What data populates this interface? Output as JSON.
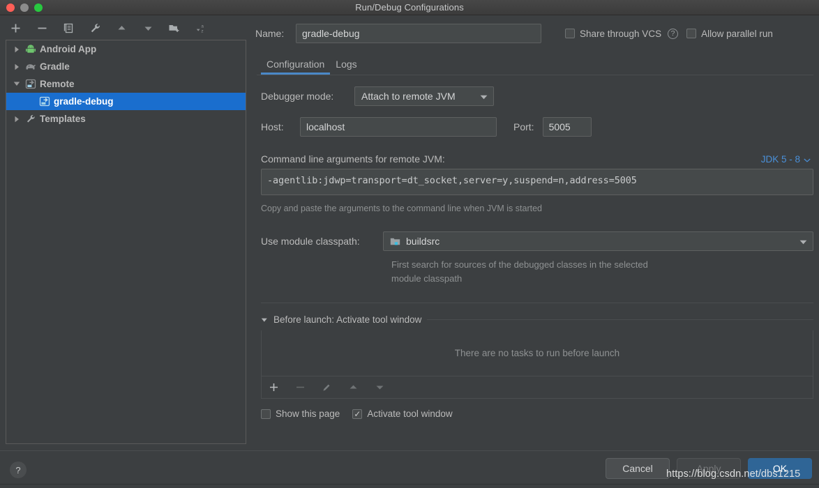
{
  "window": {
    "title": "Run/Debug Configurations",
    "traffic_lights": [
      "close",
      "minimize",
      "zoom"
    ]
  },
  "left_toolbar": {
    "buttons": [
      {
        "name": "add-configuration",
        "icon": "plus-icon"
      },
      {
        "name": "remove-configuration",
        "icon": "minus-icon"
      },
      {
        "name": "copy-configuration",
        "icon": "copy-icon"
      },
      {
        "name": "edit-templates",
        "icon": "wrench-icon"
      },
      {
        "name": "move-up",
        "icon": "arrow-up-icon"
      },
      {
        "name": "move-down",
        "icon": "arrow-down-icon"
      },
      {
        "name": "new-folder",
        "icon": "folder-add-icon"
      },
      {
        "name": "sort-configurations",
        "icon": "sort-az-icon"
      }
    ]
  },
  "tree": {
    "items": [
      {
        "label": "Android App",
        "icon": "android-icon",
        "twisty": "collapsed",
        "depth": 0,
        "selected": false
      },
      {
        "label": "Gradle",
        "icon": "gradle-icon",
        "twisty": "collapsed",
        "depth": 0,
        "selected": false
      },
      {
        "label": "Remote",
        "icon": "remote-icon",
        "twisty": "expanded",
        "depth": 0,
        "selected": false
      },
      {
        "label": "gradle-debug",
        "icon": "remote-icon",
        "twisty": "none",
        "depth": 1,
        "selected": true
      },
      {
        "label": "Templates",
        "icon": "wrench-icon",
        "twisty": "collapsed",
        "depth": 0,
        "selected": false
      }
    ]
  },
  "form": {
    "name_label": "Name:",
    "name_value": "gradle-debug",
    "share_vcs_label": "Share through VCS",
    "share_vcs_checked": false,
    "share_vcs_help": "?",
    "allow_parallel_label": "Allow parallel run",
    "allow_parallel_checked": false
  },
  "tabs": [
    {
      "label": "Configuration",
      "active": true
    },
    {
      "label": "Logs",
      "active": false
    }
  ],
  "configuration": {
    "debugger_mode_label": "Debugger mode:",
    "debugger_mode_value": "Attach to remote JVM",
    "host_label": "Host:",
    "host_value": "localhost",
    "port_label": "Port:",
    "port_value": "5005",
    "args_title": "Command line arguments for remote JVM:",
    "jdk_label": "JDK 5 - 8",
    "args_value": "-agentlib:jdwp=transport=dt_socket,server=y,suspend=n,address=5005",
    "args_hint": "Copy and paste the arguments to the command line when JVM is started",
    "classpath_label": "Use module classpath:",
    "classpath_value": "buildsrc",
    "classpath_hint_line1": "First search for sources of the debugged classes in the selected",
    "classpath_hint_line2": "module classpath"
  },
  "before_launch": {
    "title": "Before launch: Activate tool window",
    "empty_text": "There are no tasks to run before launch",
    "toolbar": [
      {
        "name": "add-task",
        "icon": "plus-icon",
        "enabled": true
      },
      {
        "name": "remove-task",
        "icon": "minus-icon",
        "enabled": false
      },
      {
        "name": "edit-task",
        "icon": "pencil-icon",
        "enabled": false
      },
      {
        "name": "move-task-up",
        "icon": "arrow-up-icon",
        "enabled": false
      },
      {
        "name": "move-task-down",
        "icon": "arrow-down-icon",
        "enabled": false
      }
    ],
    "show_page_label": "Show this page",
    "show_page_checked": false,
    "activate_tool_window_label": "Activate tool window",
    "activate_tool_window_checked": true
  },
  "footer": {
    "help_label": "?",
    "cancel_label": "Cancel",
    "apply_label": "Apply",
    "apply_enabled": false,
    "ok_label": "OK"
  },
  "watermark": "https://blog.csdn.net/dbs1215",
  "colors": {
    "window_bg": "#3c3f41",
    "selection_blue": "#1a6ece",
    "accent_link": "#4a90d9",
    "tab_underline": "#4a88c7",
    "ok_button": "#2f6596",
    "field_bg": "#45494a"
  }
}
